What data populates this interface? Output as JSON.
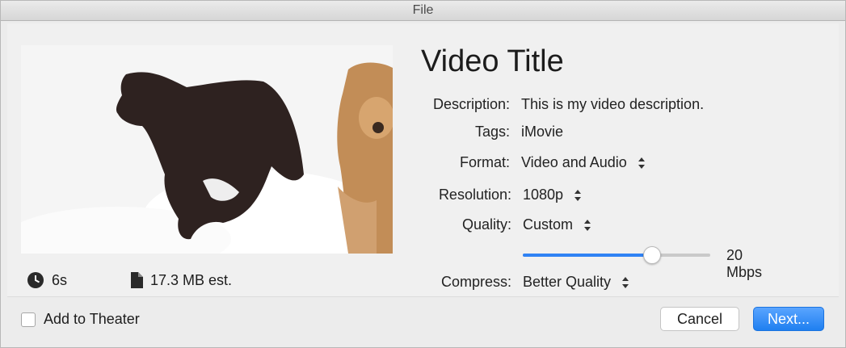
{
  "window": {
    "title": "File"
  },
  "preview": {
    "duration": "6s",
    "size": "17.3 MB est.",
    "clock_icon": "clock-icon",
    "file_icon": "file-icon"
  },
  "video": {
    "title": "Video Title"
  },
  "fields": {
    "description_label": "Description:",
    "description_value": "This is my video description.",
    "tags_label": "Tags:",
    "tags_value": "iMovie",
    "format_label": "Format:",
    "format_value": "Video and Audio",
    "resolution_label": "Resolution:",
    "resolution_value": "1080p",
    "quality_label": "Quality:",
    "quality_value": "Custom",
    "quality_slider_value": 0.69,
    "bitrate": "20 Mbps",
    "compress_label": "Compress:",
    "compress_value": "Better Quality"
  },
  "footer": {
    "add_to_theater": "Add to Theater",
    "add_to_theater_checked": false,
    "cancel": "Cancel",
    "next": "Next..."
  },
  "colors": {
    "accent": "#2f82f4",
    "window_bg": "#ececec"
  }
}
